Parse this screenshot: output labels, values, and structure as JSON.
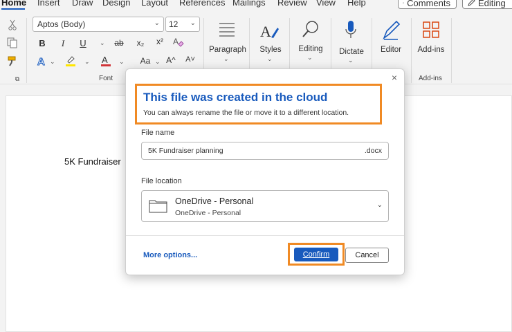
{
  "ribbon_tabs": [
    "Home",
    "Insert",
    "Draw",
    "Design",
    "Layout",
    "References",
    "Mailings",
    "Review",
    "View",
    "Help"
  ],
  "top_buttons": {
    "comments": "Comments",
    "editing": "Editing"
  },
  "font": {
    "name": "Aptos (Body)",
    "size": "12"
  },
  "format_buttons": {
    "bold": "B",
    "italic": "I",
    "underline": "U",
    "strike": "ab",
    "subscript": "x₂",
    "superscript": "x²",
    "case": "Aa",
    "grow": "A^",
    "shrink": "A˅"
  },
  "groups": {
    "font_label": "Font",
    "paragraph_label": "Paragraph",
    "styles_label": "Styles",
    "editing_label": "Editing",
    "dictate_label": "Dictate",
    "editor_label": "Editor",
    "addins_label": "Add-ins",
    "addins_group_label": "Add-ins"
  },
  "document": {
    "visible_text": "5K Fundraiser"
  },
  "dialog": {
    "close": "×",
    "title": "This file was created in the cloud",
    "subtitle": "You can always rename the file or move it to a different location.",
    "file_name_label": "File name",
    "file_name_value": "5K Fundraiser planning",
    "file_extension": ".docx",
    "file_location_label": "File location",
    "location_main": "OneDrive - Personal",
    "location_sub": "OneDrive - Personal",
    "more_options": "More options...",
    "confirm": "Confirm",
    "cancel": "Cancel"
  },
  "colors": {
    "accent": "#185abd",
    "highlight_box": "#f08a24",
    "font_color_red": "#d13438",
    "highlight_yellow": "#ffe600"
  }
}
